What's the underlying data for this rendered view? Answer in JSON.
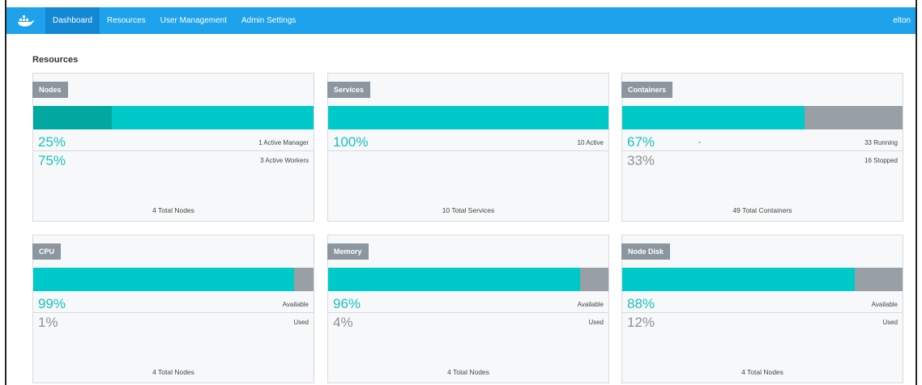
{
  "nav": {
    "items": [
      "Dashboard",
      "Resources",
      "User Management",
      "Admin Settings"
    ],
    "user": "elton"
  },
  "colors": {
    "nav_bg": "#1ea2ec",
    "nav_active": "#1489d3",
    "bar_fill": "#00c9c9",
    "bar_empty": "#989fa5",
    "percent_teal": "#1dbfbf",
    "percent_gray": "#8a9297"
  },
  "icons": {
    "logo": "docker-whale-icon"
  },
  "section_title": "Resources",
  "cards": [
    {
      "tag": "Nodes",
      "bar_fill_fraction": 1.0,
      "bar_segment_fraction": 0.28,
      "rows": [
        {
          "percent": "25%",
          "label": "1 Active Manager",
          "style": "teal"
        },
        {
          "percent": "75%",
          "label": "3 Active Workers",
          "style": "teal"
        }
      ],
      "total": "4 Total Nodes"
    },
    {
      "tag": "Services",
      "bar_fill_fraction": 1.0,
      "bar_segment_fraction": 0,
      "rows": [
        {
          "percent": "100%",
          "label": "10 Active",
          "style": "teal"
        },
        {
          "percent": "",
          "label": "",
          "style": "gray"
        }
      ],
      "total": "10 Total Services"
    },
    {
      "tag": "Containers",
      "bar_fill_fraction": 0.65,
      "bar_segment_fraction": 0,
      "rows": [
        {
          "percent": "67%",
          "label": "33 Running",
          "style": "teal"
        },
        {
          "percent": "33%",
          "label": "16 Stopped",
          "style": "gray"
        }
      ],
      "extra_mark": "-",
      "total": "49 Total Containers"
    },
    {
      "tag": "CPU",
      "bar_fill_fraction": 0.93,
      "bar_segment_fraction": 0,
      "rows": [
        {
          "percent": "99%",
          "label": "Available",
          "style": "teal"
        },
        {
          "percent": "1%",
          "label": "Used",
          "style": "gray"
        }
      ],
      "total": "4 Total Nodes"
    },
    {
      "tag": "Memory",
      "bar_fill_fraction": 0.9,
      "bar_segment_fraction": 0,
      "rows": [
        {
          "percent": "96%",
          "label": "Available",
          "style": "teal"
        },
        {
          "percent": "4%",
          "label": "Used",
          "style": "gray"
        }
      ],
      "total": "4 Total Nodes"
    },
    {
      "tag": "Node Disk",
      "bar_fill_fraction": 0.83,
      "bar_segment_fraction": 0,
      "rows": [
        {
          "percent": "88%",
          "label": "Available",
          "style": "teal"
        },
        {
          "percent": "12%",
          "label": "Used",
          "style": "gray"
        }
      ],
      "total": "4 Total Nodes"
    }
  ]
}
